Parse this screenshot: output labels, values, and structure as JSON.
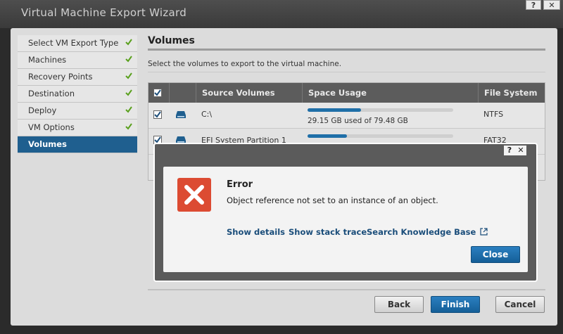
{
  "window": {
    "title": "Virtual Machine Export Wizard",
    "help_glyph": "?",
    "close_glyph": "✕"
  },
  "steps": [
    {
      "label": "Select VM Export Type",
      "done": true
    },
    {
      "label": "Machines",
      "done": true
    },
    {
      "label": "Recovery Points",
      "done": true
    },
    {
      "label": "Destination",
      "done": true
    },
    {
      "label": "Deploy",
      "done": true
    },
    {
      "label": "VM Options",
      "done": true
    },
    {
      "label": "Volumes",
      "done": false,
      "active": true
    }
  ],
  "page": {
    "title": "Volumes",
    "description": "Select the volumes to export to the virtual machine."
  },
  "table": {
    "columns": [
      "Source Volumes",
      "Space Usage",
      "File System"
    ],
    "rows": [
      {
        "checked": true,
        "name": "C:\\",
        "usage_text": "29.15 GB used of 79.48 GB",
        "usage_fraction": 0.367,
        "fs": "NTFS"
      },
      {
        "checked": true,
        "name": "EFI System Partition 1",
        "usage_text": "",
        "usage_fraction": 0.27,
        "fs": "FAT32"
      }
    ]
  },
  "footer": {
    "back": "Back",
    "finish": "Finish",
    "cancel": "Cancel"
  },
  "error_dialog": {
    "help_glyph": "?",
    "close_glyph": "✕",
    "title": "Error",
    "message": "Object reference not set to an instance of an object.",
    "links": {
      "details": "Show details",
      "stack": "Show stack trace",
      "kb": "Search Knowledge Base"
    },
    "close_label": "Close"
  },
  "colors": {
    "accent": "#1f5f8f",
    "error": "#dc4b32",
    "check": "#5aa01e"
  }
}
